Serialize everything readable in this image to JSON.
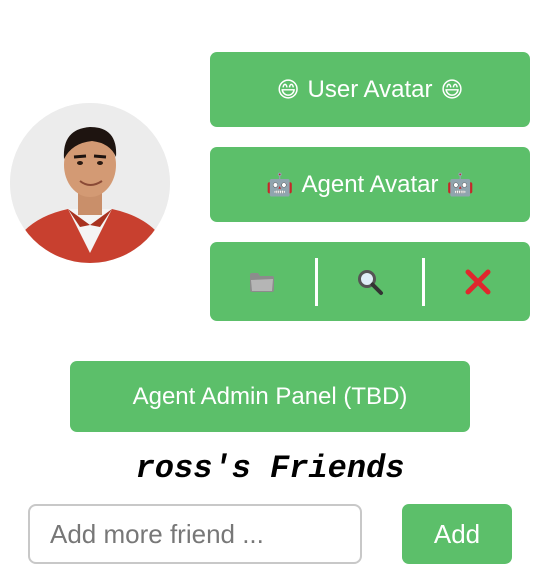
{
  "avatar": {
    "alt": "current-user-avatar"
  },
  "buttons": {
    "user_avatar": {
      "emoji_left": "😄",
      "label": "User Avatar",
      "emoji_right": "😄"
    },
    "agent_avatar": {
      "emoji_left": "🤖",
      "label": "Agent Avatar",
      "emoji_right": "🤖"
    },
    "admin_panel": {
      "label": "Agent Admin Panel (TBD)"
    },
    "add": {
      "label": "Add"
    }
  },
  "toolbar": {
    "items": [
      {
        "icon": "folder-icon"
      },
      {
        "icon": "magnifier-icon"
      },
      {
        "icon": "close-icon"
      }
    ]
  },
  "friends": {
    "title": "ross's Friends",
    "input_placeholder": "Add more friend ...",
    "input_value": ""
  },
  "colors": {
    "button_green": "#5cbf6a",
    "close_red": "#e0282d"
  }
}
